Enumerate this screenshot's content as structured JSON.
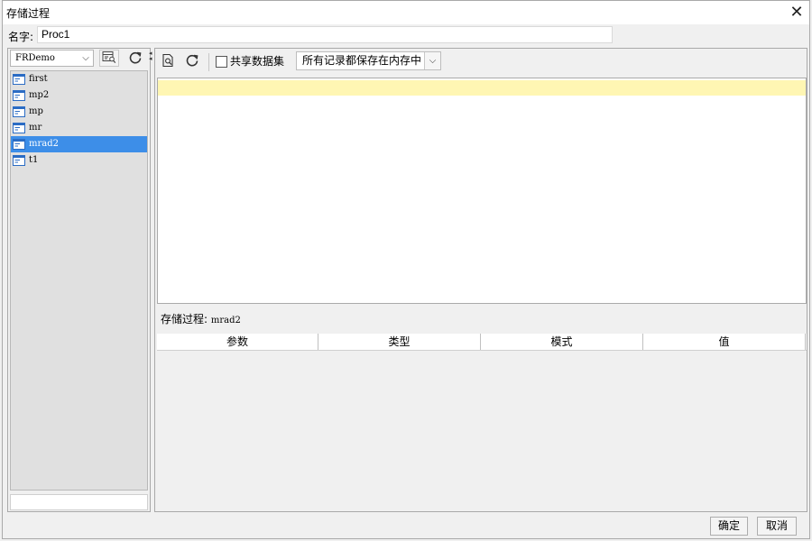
{
  "window": {
    "title": "存储过程",
    "close_glyph": "✕"
  },
  "name_field": {
    "label": "名字:",
    "value": "Proc1"
  },
  "left_panel": {
    "datasource": "FRDemo",
    "procedures": [
      {
        "name": "first",
        "selected": false
      },
      {
        "name": "mp2",
        "selected": false
      },
      {
        "name": "mp",
        "selected": false
      },
      {
        "name": "mr",
        "selected": false
      },
      {
        "name": "mrad2",
        "selected": true
      },
      {
        "name": "t1",
        "selected": false
      }
    ]
  },
  "toolbar": {
    "share_label": "共享数据集",
    "share_checked": false,
    "memory_option": "所有记录都保存在内存中"
  },
  "details": {
    "proc_label": "存储过程:",
    "proc_value": "mrad2"
  },
  "params_table": {
    "columns": [
      "参数",
      "类型",
      "模式",
      "值"
    ]
  },
  "footer": {
    "ok_label": "确定",
    "cancel_label": "取消"
  },
  "colors": {
    "selection": "#3d8ee8",
    "editor_highlight": "#fff6b3",
    "icon_blue": "#2b6cc4"
  }
}
